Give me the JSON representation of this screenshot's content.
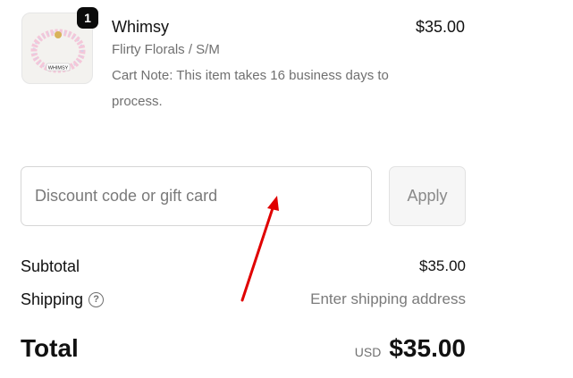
{
  "line_item": {
    "quantity": "1",
    "name": "Whimsy",
    "variant": "Flirty Florals / S/M",
    "note": "Cart Note: This item takes 16 business days to process.",
    "price": "$35.00"
  },
  "discount": {
    "placeholder": "Discount code or gift card",
    "apply_label": "Apply"
  },
  "summary": {
    "subtotal_label": "Subtotal",
    "subtotal_value": "$35.00",
    "shipping_label": "Shipping",
    "shipping_value": "Enter shipping address",
    "total_label": "Total",
    "currency": "USD",
    "total_value": "$35.00"
  },
  "icons": {
    "help": "help-icon",
    "annotation": "red-arrow"
  },
  "colors": {
    "badge": "#0b0b0b",
    "arrow": "#e00000",
    "muted_text": "#707070"
  }
}
